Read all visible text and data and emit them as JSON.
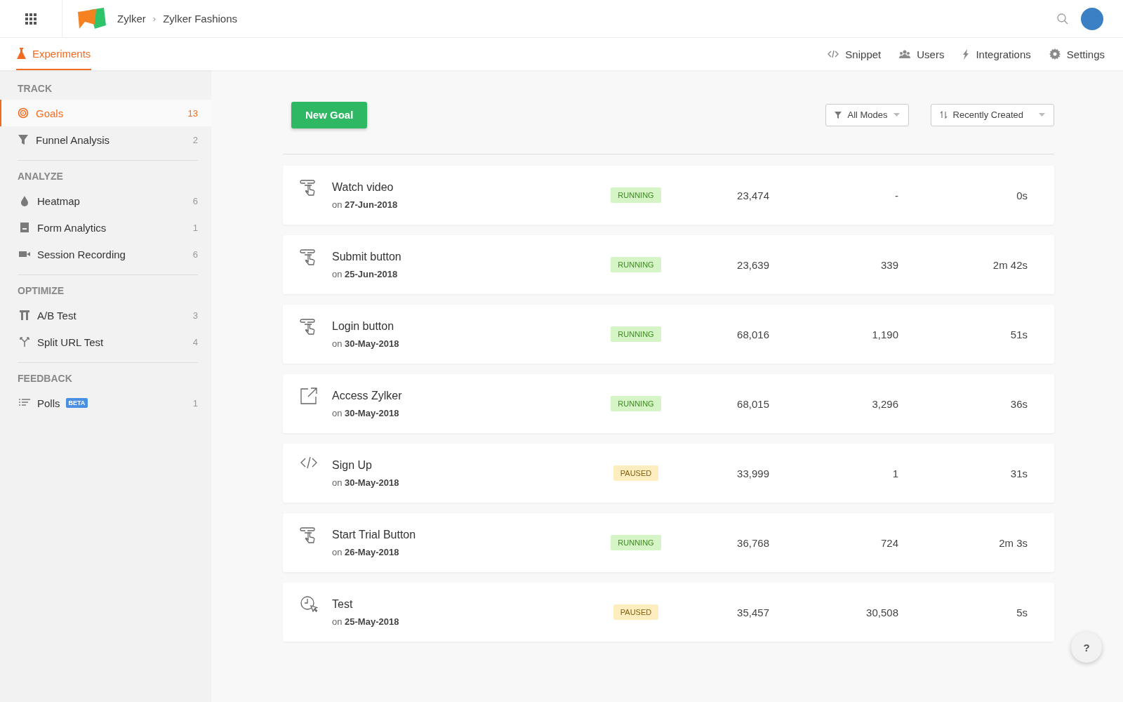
{
  "topbar": {
    "breadcrumb": [
      "Zylker",
      "Zylker Fashions"
    ],
    "separator": "›"
  },
  "tabs": [
    {
      "label": "Experiments",
      "selected": true
    }
  ],
  "nav_links": [
    {
      "label": "Snippet",
      "kind": "code"
    },
    {
      "label": "Users",
      "kind": "users"
    },
    {
      "label": "Integrations",
      "kind": "bolt"
    },
    {
      "label": "Settings",
      "kind": "gear"
    }
  ],
  "sidebar": {
    "sections": [
      {
        "title": "TRACK",
        "items": [
          {
            "label": "Goals",
            "count": "13",
            "kind": "target",
            "selected": true
          },
          {
            "label": "Funnel Analysis",
            "count": "2",
            "kind": "funnel",
            "selected": false
          }
        ]
      },
      {
        "title": "ANALYZE",
        "items": [
          {
            "label": "Heatmap",
            "count": "6",
            "kind": "drop",
            "selected": false
          },
          {
            "label": "Form Analytics",
            "count": "1",
            "kind": "form",
            "selected": false
          },
          {
            "label": "Session Recording",
            "count": "6",
            "kind": "camera",
            "selected": false
          }
        ]
      },
      {
        "title": "OPTIMIZE",
        "items": [
          {
            "label": "A/B Test",
            "count": "3",
            "kind": "ab",
            "selected": false
          },
          {
            "label": "Split URL Test",
            "count": "4",
            "kind": "split",
            "selected": false
          }
        ]
      },
      {
        "title": "FEEDBACK",
        "items": [
          {
            "label": "Polls",
            "badge": "BETA",
            "count": "1",
            "kind": "polls",
            "selected": false
          }
        ]
      }
    ]
  },
  "toolbar": {
    "new_button": "New Goal",
    "filter": "All Modes",
    "sort": "Recently Created"
  },
  "goals": [
    {
      "kind": "click",
      "name": "Watch video",
      "date": "on **27-Jun-2018**",
      "status": {
        "label": "RUNNING",
        "kind": "running"
      },
      "column_3": "23,474",
      "column_4": "-",
      "column_5": "0s"
    },
    {
      "kind": "click",
      "name": "Submit button",
      "date": "on **25-Jun-2018**",
      "status": {
        "label": "RUNNING",
        "kind": "running"
      },
      "column_3": "23,639",
      "column_4": "339",
      "column_5": "2m 42s"
    },
    {
      "kind": "click",
      "name": "Login button",
      "date": "on **30-May-2018**",
      "status": {
        "label": "RUNNING",
        "kind": "running"
      },
      "column_3": "68,016",
      "column_4": "1,190",
      "column_5": "51s"
    },
    {
      "kind": "link",
      "name": "Access Zylker",
      "date": "on **30-May-2018**",
      "status": {
        "label": "RUNNING",
        "kind": "running"
      },
      "column_3": "68,015",
      "column_4": "3,296",
      "column_5": "36s"
    },
    {
      "kind": "code",
      "name": "Sign Up",
      "date": "on **30-May-2018**",
      "status": {
        "label": "PAUSED",
        "kind": "paused"
      },
      "column_3": "33,999",
      "column_4": "1",
      "column_5": "31s"
    },
    {
      "kind": "click",
      "name": "Start Trial Button",
      "date": "on **26-May-2018**",
      "status": {
        "label": "RUNNING",
        "kind": "running"
      },
      "column_3": "36,768",
      "column_4": "724",
      "column_5": "2m 3s"
    },
    {
      "kind": "clock",
      "name": "Test",
      "date": "on **25-May-2018**",
      "status": {
        "label": "PAUSED",
        "kind": "paused"
      },
      "column_3": "35,457",
      "column_4": "30,508",
      "column_5": "5s"
    }
  ],
  "help_button": "?"
}
